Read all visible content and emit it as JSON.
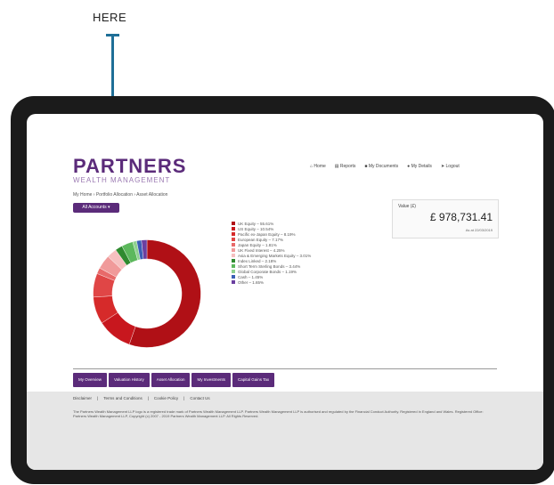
{
  "callout": {
    "label": "HERE"
  },
  "colors": {
    "brand": "#5b2b7a",
    "callout": "#1f6f97"
  },
  "logo": {
    "title": "PARTNERS",
    "subtitle": "WEALTH MANAGEMENT"
  },
  "topnav": [
    {
      "icon": "home-icon",
      "label": "Home"
    },
    {
      "icon": "reports-icon",
      "label": "Reports"
    },
    {
      "icon": "documents-icon",
      "label": "My Documents"
    },
    {
      "icon": "user-icon",
      "label": "My Details"
    },
    {
      "icon": "logout-icon",
      "label": "Logout"
    }
  ],
  "breadcrumb": "My Home › Portfolio Allocation › Asset Allocation",
  "accounts_button": "All Accounts ▾",
  "legend_items": [
    {
      "label": "UK Equity – 55.61%",
      "color": "#b01016"
    },
    {
      "label": "US Equity – 10.54%",
      "color": "#c8171e"
    },
    {
      "label": "Pacific ex-Japan Equity – 8.19%",
      "color": "#d62a2a"
    },
    {
      "label": "European Equity – 7.17%",
      "color": "#e04646"
    },
    {
      "label": "Japan Equity – 1.81%",
      "color": "#e86a6a"
    },
    {
      "label": "UK Fixed Interest – 4.25%",
      "color": "#f09a9a"
    },
    {
      "label": "Asia & Emerging Markets Equity – 3.01%",
      "color": "#f6c0c0"
    },
    {
      "label": "Index Linked – 2.18%",
      "color": "#2f8a2f"
    },
    {
      "label": "Short Term Sterling Bonds – 3.44%",
      "color": "#5cb85c"
    },
    {
      "label": "Global Corporate Bonds – 1.19%",
      "color": "#8fd18f"
    },
    {
      "label": "Cash – 1.45%",
      "color": "#3b5fb5"
    },
    {
      "label": "Other – 1.65%",
      "color": "#6b3fa0"
    }
  ],
  "total": {
    "label": "Value (£)",
    "value": "£ 978,731.41",
    "date": "As at 22/03/2019"
  },
  "tabs": [
    "My Overview",
    "Valuation History",
    "Asset Allocation",
    "My Investments",
    "Capital Gains Tax"
  ],
  "footer": {
    "links": [
      "Disclaimer",
      "Terms and Conditions",
      "Cookie Policy",
      "Contact Us"
    ],
    "text": "The Partners Wealth Management LLP logo is a registered trade mark of Partners Wealth Management LLP. Partners Wealth Management LLP is authorised and regulated by the Financial Conduct Authority. Registered in England and Wales. Registered Office: Partners Wealth Management LLP, Copyright (c) 2007 - 2019 Partners Wealth Management LLP. All Rights Reserved."
  },
  "chart_data": {
    "type": "pie",
    "values": [
      55.61,
      10.54,
      8.19,
      7.17,
      1.81,
      4.25,
      3.01,
      2.18,
      3.44,
      1.19,
      1.45,
      1.65
    ],
    "categories": [
      "UK Equity",
      "US Equity",
      "Pacific ex-Japan Equity",
      "European Equity",
      "Japan Equity",
      "UK Fixed Interest",
      "Asia & Emerging Markets Equity",
      "Index Linked",
      "Short Term Sterling Bonds",
      "Global Corporate Bonds",
      "Cash",
      "Other"
    ]
  }
}
